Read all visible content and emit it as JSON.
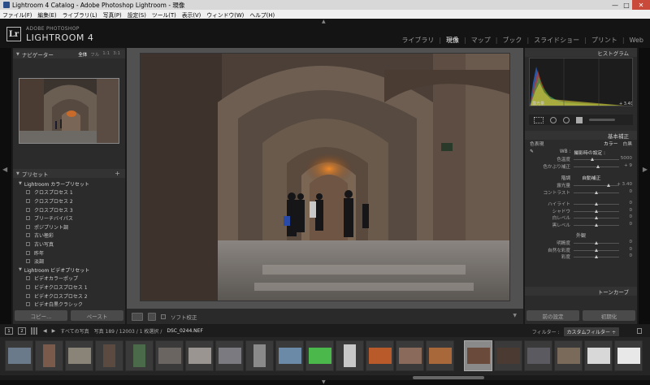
{
  "window": {
    "title": "Lightroom 4 Catalog - Adobe Photoshop Lightroom - 現像",
    "controls": [
      "—",
      "□",
      "✕"
    ]
  },
  "menu": [
    "ファイル(F)",
    "編集(E)",
    "ライブラリ(L)",
    "写真(P)",
    "設定(S)",
    "ツール(T)",
    "表示(V)",
    "ウィンドウ(W)",
    "ヘルプ(H)"
  ],
  "brand": {
    "logo": "Lr",
    "sub": "ADOBE PHOTOSHOP",
    "main": "LIGHTROOM 4"
  },
  "modules": [
    "ライブラリ",
    "現像",
    "マップ",
    "ブック",
    "スライドショー",
    "プリント",
    "Web"
  ],
  "active_module": "現像",
  "left": {
    "navigator_title": "ナビゲーター",
    "zoom": [
      "全体",
      "フル",
      "1:1",
      "3:1"
    ],
    "presets_title": "プリセット",
    "presets": [
      {
        "label": "Lightroom カラープリセット",
        "type": "folder"
      },
      {
        "label": "クロスプロセス 1",
        "type": "item"
      },
      {
        "label": "クロスプロセス 2",
        "type": "item"
      },
      {
        "label": "クロスプロセス 3",
        "type": "item"
      },
      {
        "label": "ブリーチバイパス",
        "type": "item"
      },
      {
        "label": "ポジプリント調",
        "type": "item"
      },
      {
        "label": "古い極彩",
        "type": "item"
      },
      {
        "label": "古い写真",
        "type": "item"
      },
      {
        "label": "昨年",
        "type": "item"
      },
      {
        "label": "淡調",
        "type": "item"
      },
      {
        "label": "Lightroom ビデオプリセット",
        "type": "folder"
      },
      {
        "label": "ビデオカラーポップ",
        "type": "item"
      },
      {
        "label": "ビデオクロスプロセス 1",
        "type": "item"
      },
      {
        "label": "ビデオクロスプロセス 2",
        "type": "item"
      },
      {
        "label": "ビデオ白黒クラシック",
        "type": "item"
      }
    ],
    "copy_label": "コピー...",
    "paste_label": "ペースト"
  },
  "toolbar": {
    "soft_proof": "ソフト校正"
  },
  "right": {
    "histogram_title": "ヒストグラム",
    "histo_left": "露光量",
    "histo_right": "+ 3.40",
    "basic_title": "基本補正",
    "treatment_label": "色表現",
    "treatment_color": "カラー",
    "treatment_bw": "白黒",
    "wb_label": "WB :",
    "wb_value": "撮影時の設定 :",
    "tone_label": "階調",
    "auto_label": "自動補正",
    "presence_label": "外観",
    "tone_curve_title": "トーンカーブ",
    "sliders_wb": [
      {
        "label": "色温度",
        "value": "5000",
        "pos": 0.42
      },
      {
        "label": "色かぶり補正",
        "value": "+ 9",
        "pos": 0.55
      }
    ],
    "sliders_tone": [
      {
        "label": "露光量",
        "value": "+ 3.40",
        "pos": 0.78
      },
      {
        "label": "コントラスト",
        "value": "0",
        "pos": 0.5
      }
    ],
    "sliders_tone2": [
      {
        "label": "ハイライト",
        "value": "0",
        "pos": 0.5
      },
      {
        "label": "シャドウ",
        "value": "0",
        "pos": 0.5
      },
      {
        "label": "白レベル",
        "value": "0",
        "pos": 0.5
      },
      {
        "label": "黒レベル",
        "value": "0",
        "pos": 0.5
      }
    ],
    "sliders_presence": [
      {
        "label": "明瞭度",
        "value": "0",
        "pos": 0.5
      },
      {
        "label": "自然な彩度",
        "value": "0",
        "pos": 0.5
      },
      {
        "label": "彩度",
        "value": "0",
        "pos": 0.5
      }
    ],
    "prev_label": "前の設定",
    "reset_label": "初期化"
  },
  "filmstrip": {
    "page1": "1",
    "page2": "2",
    "source": "すべての写真",
    "count": "写真 189 / 12003 / 1 枚選択 /",
    "filename": "DSC_0244.NEF",
    "filter_label": "フィルター :",
    "filter_value": "カスタムフィルター ÷"
  }
}
